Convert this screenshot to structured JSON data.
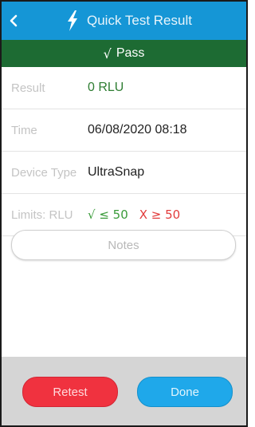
{
  "header": {
    "title": "Quick Test Result",
    "back_icon": "chevron-left-icon",
    "bolt_icon": "lightning-bolt-icon",
    "color": "#1596d6"
  },
  "status": {
    "check": "√",
    "label": "Pass",
    "color": "#1d6b33"
  },
  "rows": {
    "result": {
      "label": "Result",
      "value": "0 RLU"
    },
    "time": {
      "label": "Time",
      "value": "06/08/2020 08:18"
    },
    "device": {
      "label": "Device Type",
      "value": "UltraSnap"
    },
    "limits": {
      "label": "Limits: RLU",
      "pass": "√ ≤ 50",
      "fail": "X ≥ 50"
    }
  },
  "notes": {
    "label": "Notes"
  },
  "footer": {
    "retest_label": "Retest",
    "done_label": "Done",
    "retest_color": "#f0323f",
    "done_color": "#1fa8ea"
  }
}
